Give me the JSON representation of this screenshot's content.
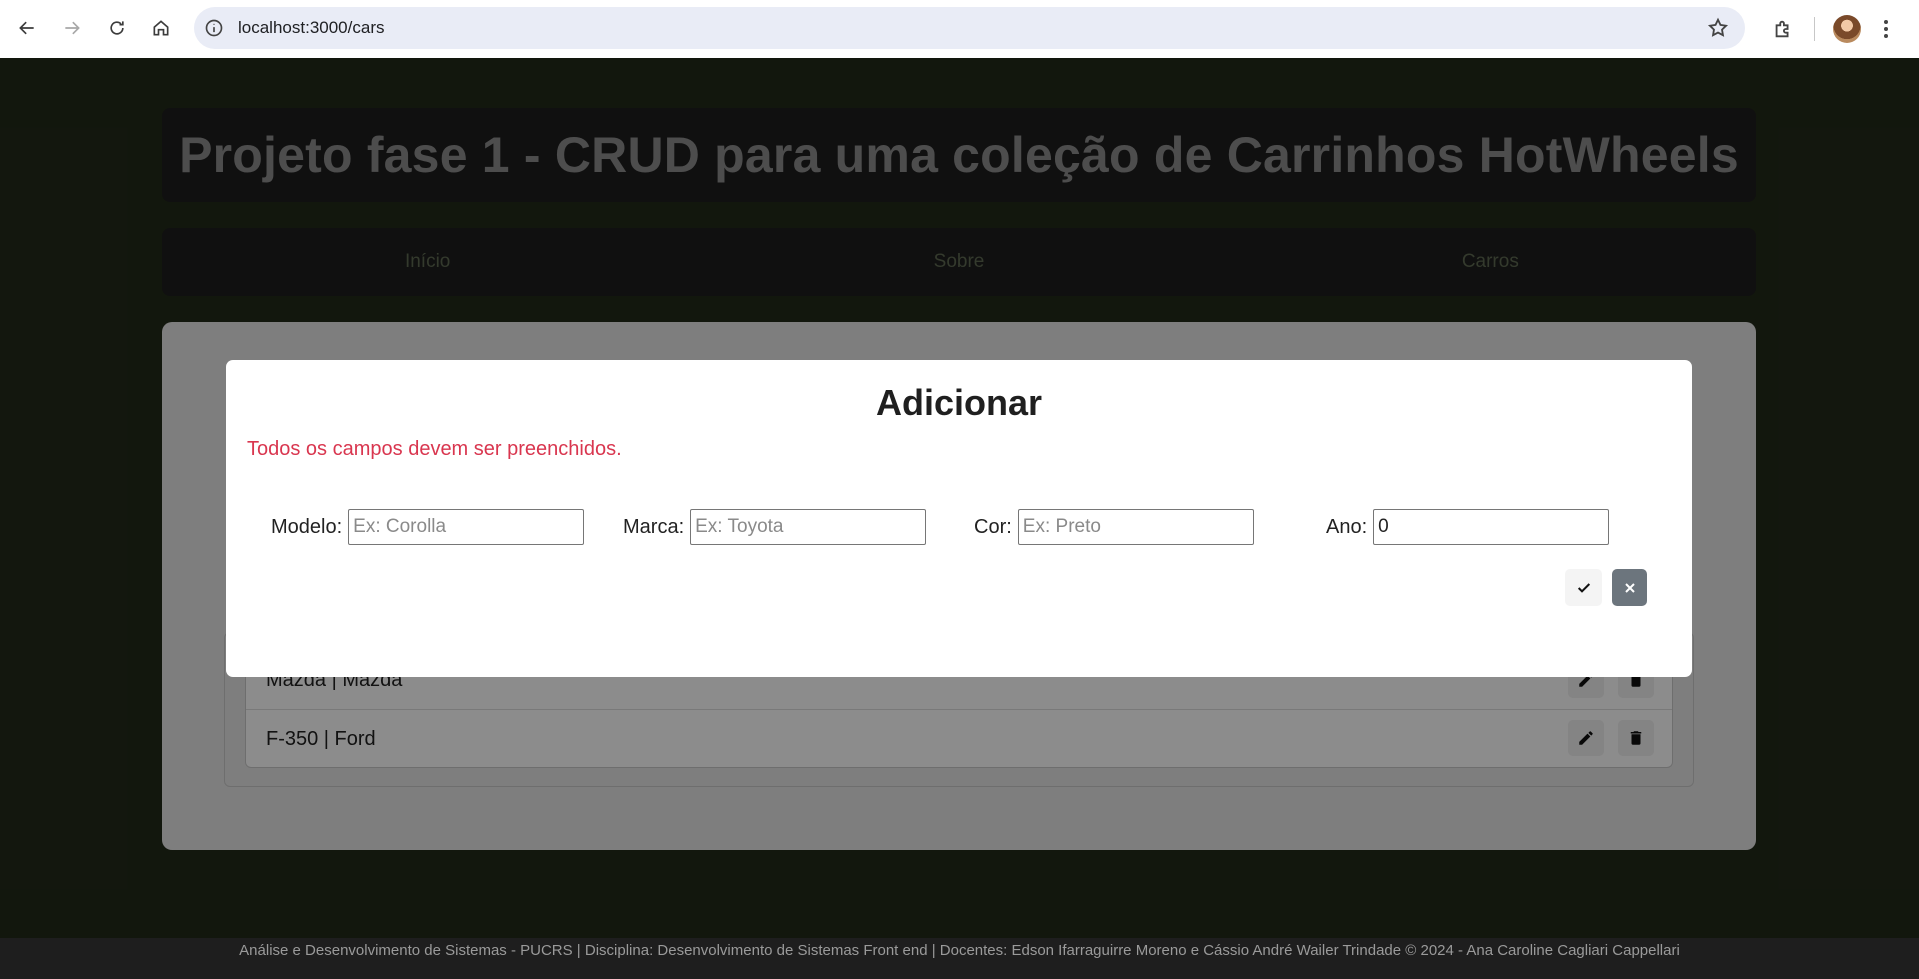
{
  "browser": {
    "url": "localhost:3000/cars"
  },
  "header": {
    "title": "Projeto fase 1 - CRUD para uma coleção de Carrinhos HotWheels"
  },
  "nav": {
    "items": [
      {
        "label": "Início"
      },
      {
        "label": "Sobre"
      },
      {
        "label": "Carros"
      }
    ]
  },
  "list": {
    "rows": [
      {
        "label": "Mazda | Mazda"
      },
      {
        "label": "F-350 | Ford"
      }
    ]
  },
  "modal": {
    "title": "Adicionar",
    "error": "Todos os campos devem ser preenchidos.",
    "fields": {
      "modelo": {
        "label": "Modelo:",
        "placeholder": "Ex: Corolla",
        "value": ""
      },
      "marca": {
        "label": "Marca:",
        "placeholder": "Ex: Toyota",
        "value": ""
      },
      "cor": {
        "label": "Cor:",
        "placeholder": "Ex: Preto",
        "value": ""
      },
      "ano": {
        "label": "Ano:",
        "placeholder": "",
        "value": "0"
      }
    }
  },
  "footer": {
    "text": "Análise e Desenvolvimento de Sistemas - PUCRS | Disciplina: Desenvolvimento de Sistemas Front end | Docentes: Edson Ifarraguirre Moreno e Cássio André Wailer Trindade © 2024 - Ana Caroline Cagliari Cappellari"
  },
  "colors": {
    "page_background": "#222a19",
    "bar_background": "#1e1e1e",
    "error_text": "#d9364f",
    "cancel_button": "#6c757d"
  }
}
